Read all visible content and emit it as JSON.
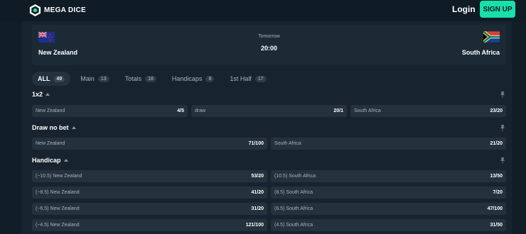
{
  "brand": {
    "name": "MEGA DICE",
    "accent": "#17e0a8"
  },
  "header": {
    "login_label": "Login",
    "signup_label": "SIGN UP"
  },
  "event": {
    "home": "New Zealand",
    "away": "South Africa",
    "day": "Tomorrow",
    "time": "20:00",
    "home_flag": "new-zealand-flag",
    "away_flag": "south-africa-flag"
  },
  "tabs": [
    {
      "label": "ALL",
      "count": "49"
    },
    {
      "label": "Main",
      "count": "13"
    },
    {
      "label": "Totals",
      "count": "18"
    },
    {
      "label": "Handicaps",
      "count": "8"
    },
    {
      "label": "1st Half",
      "count": "17"
    }
  ],
  "markets": {
    "x12": {
      "title": "1x2",
      "odds": [
        {
          "label": "New Zealand",
          "value": "4/5"
        },
        {
          "label": "draw",
          "value": "20/1"
        },
        {
          "label": "South Africa",
          "value": "23/20"
        }
      ]
    },
    "dnb": {
      "title": "Draw no bet",
      "odds": [
        {
          "label": "New Zealand",
          "value": "71/100"
        },
        {
          "label": "South Africa",
          "value": "21/20"
        }
      ]
    },
    "handicap": {
      "title": "Handicap",
      "rows": [
        [
          {
            "label": "(−10.5) New Zealand",
            "value": "53/20"
          },
          {
            "label": "(10.5) South Africa",
            "value": "13/50"
          }
        ],
        [
          {
            "label": "(−8.5) New Zealand",
            "value": "41/20"
          },
          {
            "label": "(8.5) South Africa",
            "value": "7/20"
          }
        ],
        [
          {
            "label": "(−6.5) New Zealand",
            "value": "31/20"
          },
          {
            "label": "(6.5) South Africa",
            "value": "47/100"
          }
        ],
        [
          {
            "label": "(−4.5) New Zealand",
            "value": "121/100"
          },
          {
            "label": "(4.5) South Africa",
            "value": "31/50"
          }
        ]
      ]
    }
  }
}
